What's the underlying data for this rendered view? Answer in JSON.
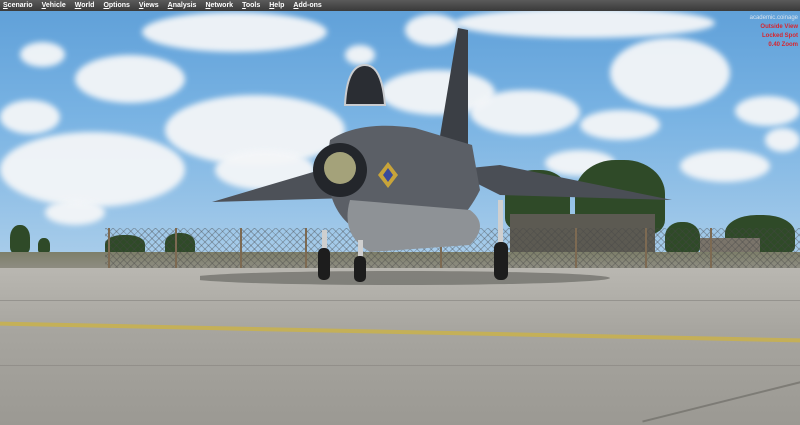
{
  "menu": {
    "items": [
      "Scenario",
      "Vehicle",
      "World",
      "Options",
      "Views",
      "Analysis",
      "Network",
      "Tools",
      "Help",
      "Add-ons"
    ]
  },
  "overlay": {
    "line1": "academic.coinage",
    "line2": "Outside View",
    "line3": "Locked Spot",
    "line4": "0.40 Zoom"
  },
  "colors": {
    "menu_bg": "#474747",
    "overlay_text": "#d7262f",
    "sky": "#79b3e3",
    "tarmac": "#a7a59f",
    "aircraft": "#6f7378",
    "taxi_line": "#c9b24b"
  }
}
